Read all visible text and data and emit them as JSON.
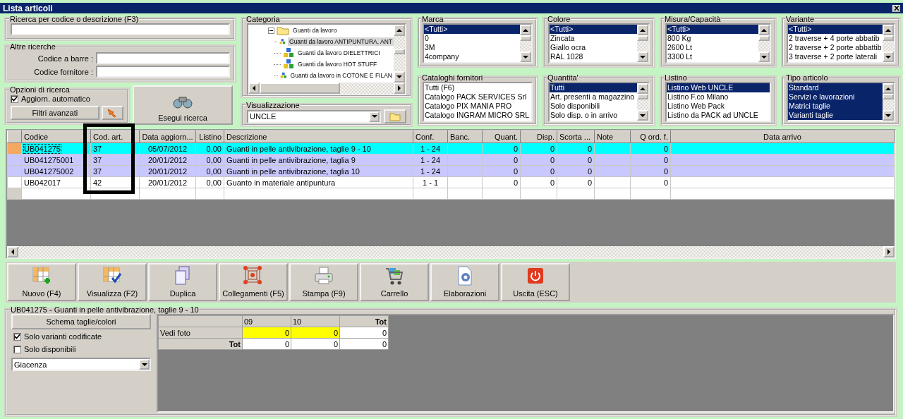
{
  "window": {
    "title": "Lista articoli"
  },
  "search": {
    "title": "Ricerca per codice o descrizione (F3)"
  },
  "other_search": {
    "title": "Altre ricerche",
    "fields": [
      {
        "label": "Codice a barre :"
      },
      {
        "label": "Codice fornitore :"
      }
    ]
  },
  "options": {
    "title": "Opzioni di ricerca",
    "auto_update": {
      "label": "Aggiorn. automatico",
      "checked": true
    },
    "filters_button": "Filtri avanzati"
  },
  "search_button": "Esegui ricerca",
  "category": {
    "title": "Categoria",
    "tree": [
      {
        "label": "Guanti da lavoro",
        "expanded": true,
        "children": [
          {
            "label": "Guanti da lavoro ANTIPUNTURA, ANT",
            "selected": true
          },
          {
            "label": "Guanti da lavoro DIELETTRICI",
            "selected": false
          },
          {
            "label": "Guanti da lavoro HOT STUFF",
            "selected": false
          },
          {
            "label": "Guanti da lavoro in COTONE E FILAN",
            "selected": false
          }
        ]
      }
    ]
  },
  "view": {
    "title": "Visualizzazione",
    "value": "UNCLE"
  },
  "filters": [
    {
      "title": "Marca",
      "scrollable": true,
      "items": [
        {
          "label": "<Tutti>",
          "selected": true
        },
        {
          "label": "0",
          "selected": false
        },
        {
          "label": "3M",
          "selected": false
        },
        {
          "label": "4company",
          "selected": false
        }
      ]
    },
    {
      "title": "Colore",
      "scrollable": true,
      "items": [
        {
          "label": "<Tutti>",
          "selected": true
        },
        {
          "label": "Zincata",
          "selected": false
        },
        {
          "label": "Giallo ocra",
          "selected": false
        },
        {
          "label": "RAL 1028",
          "selected": false
        }
      ]
    },
    {
      "title": "Misura/Capacità",
      "scrollable": true,
      "items": [
        {
          "label": "<Tutti>",
          "selected": true
        },
        {
          "label": "800 Kg",
          "selected": false
        },
        {
          "label": "2600 Lt",
          "selected": false
        },
        {
          "label": "3300 Lt",
          "selected": false
        }
      ]
    },
    {
      "title": "Variante",
      "scrollable": true,
      "items": [
        {
          "label": "<Tutti>",
          "selected": true
        },
        {
          "label": "2 traverse + 4 porte abbatib",
          "selected": false
        },
        {
          "label": "2 traverse + 2 porte abbattib",
          "selected": false
        },
        {
          "label": "3 traverse + 2 porte laterali",
          "selected": false
        }
      ]
    },
    {
      "title": "Cataloghi fornitori",
      "scrollable": false,
      "items": [
        {
          "label": "Tutti (F6)",
          "selected": false
        },
        {
          "label": "Catalogo PACK SERVICES Srl",
          "selected": false
        },
        {
          "label": "Catalogo PIX MANIA PRO",
          "selected": false
        },
        {
          "label": "Catalogo INGRAM MICRO SRL",
          "selected": false
        }
      ]
    },
    {
      "title": "Quantita'",
      "scrollable": true,
      "items": [
        {
          "label": "Tutti",
          "selected": true
        },
        {
          "label": "Art. presenti a magazzino",
          "selected": false
        },
        {
          "label": "Solo disponibili",
          "selected": false
        },
        {
          "label": "Solo disp. o in arrivo",
          "selected": false
        }
      ]
    },
    {
      "title": "Listino",
      "scrollable": false,
      "items": [
        {
          "label": "Listino Web UNCLE",
          "selected": true
        },
        {
          "label": "Listino F.co Milano",
          "selected": false
        },
        {
          "label": "Listino Web Pack",
          "selected": false
        },
        {
          "label": "Listino da PACK ad UNCLE",
          "selected": false
        }
      ]
    },
    {
      "title": "Tipo articolo",
      "scrollable": true,
      "items": [
        {
          "label": "Standard",
          "selected": true
        },
        {
          "label": "Servizi e lavorazioni",
          "selected": true
        },
        {
          "label": "Matrici taglie",
          "selected": true
        },
        {
          "label": "Varianti taglie",
          "selected": true
        }
      ]
    }
  ],
  "grid": {
    "columns": [
      "Codice",
      "Cod. art.",
      "Data aggiorn...",
      "Listino",
      "Descrizione",
      "Conf.",
      "Banc.",
      "Quant.",
      "Disp.",
      "Scorta ...",
      "Note",
      "Q ord. f.",
      "Data arrivo"
    ],
    "rows": [
      {
        "selected": true,
        "color": "#00ffff",
        "code": "UB041275",
        "article_code": "37",
        "updated": "05/07/2012",
        "list_price": "0,00",
        "description": "Guanti in pelle antivibrazione, taglie 9 - 10",
        "pack": "1 - 24",
        "quantity": "0",
        "available": "0",
        "stock": "0",
        "ordered": "0"
      },
      {
        "selected": false,
        "color": "#c8c8ff",
        "code": "UB041275001",
        "article_code": "37",
        "updated": "20/01/2012",
        "list_price": "0,00",
        "description": "Guanti in pelle antivibrazione, taglia 9",
        "pack": "1 - 24",
        "quantity": "0",
        "available": "0",
        "stock": "0",
        "ordered": "0"
      },
      {
        "selected": false,
        "color": "#c8c8ff",
        "code": "UB041275002",
        "article_code": "37",
        "updated": "20/01/2012",
        "list_price": "0,00",
        "description": "Guanti in pelle antivibrazione, taglia 10",
        "pack": "1 - 24",
        "quantity": "0",
        "available": "0",
        "stock": "0",
        "ordered": "0"
      },
      {
        "selected": false,
        "color": "#ffffff",
        "code": "UB042017",
        "article_code": "42",
        "updated": "20/01/2012",
        "list_price": "0,00",
        "description": "Guanto in materiale antipuntura",
        "pack": "1 - 1",
        "quantity": "0",
        "available": "0",
        "stock": "0",
        "ordered": "0"
      }
    ]
  },
  "toolbar": [
    {
      "label": "Nuovo (F4)",
      "kind": "new"
    },
    {
      "label": "Visualizza (F2)",
      "kind": "view"
    },
    {
      "label": "Duplica",
      "kind": "duplicate"
    },
    {
      "label": "Collegamenti (F5)",
      "kind": "links"
    },
    {
      "label": "Stampa (F9)",
      "kind": "print"
    },
    {
      "label": "Carrello",
      "kind": "cart"
    },
    {
      "label": "Elaborazioni",
      "kind": "process"
    },
    {
      "label": "Uscita (ESC)",
      "kind": "exit"
    }
  ],
  "detail": {
    "title": "UB041275 - Guanti in pelle antivibrazione, taglie 9 - 10",
    "scheme_button": "Schema taglie/colori",
    "checkboxes": [
      {
        "label": "Solo varianti codificate",
        "checked": true
      },
      {
        "label": "Solo disponibili",
        "checked": false
      }
    ],
    "select": "Giacenza",
    "matrix": {
      "columns": [
        "09",
        "10",
        "Tot"
      ],
      "rows": [
        {
          "label": "Vedi foto",
          "kind": "item",
          "cells": [
            {
              "value": "0",
              "highlighted": true
            },
            {
              "value": "0",
              "highlighted": true
            },
            {
              "value": "0",
              "highlighted": false
            }
          ]
        },
        {
          "label": "Tot",
          "kind": "total",
          "cells": [
            {
              "value": "0",
              "highlighted": false
            },
            {
              "value": "0",
              "highlighted": false
            },
            {
              "value": "0",
              "highlighted": false
            }
          ]
        }
      ]
    }
  }
}
